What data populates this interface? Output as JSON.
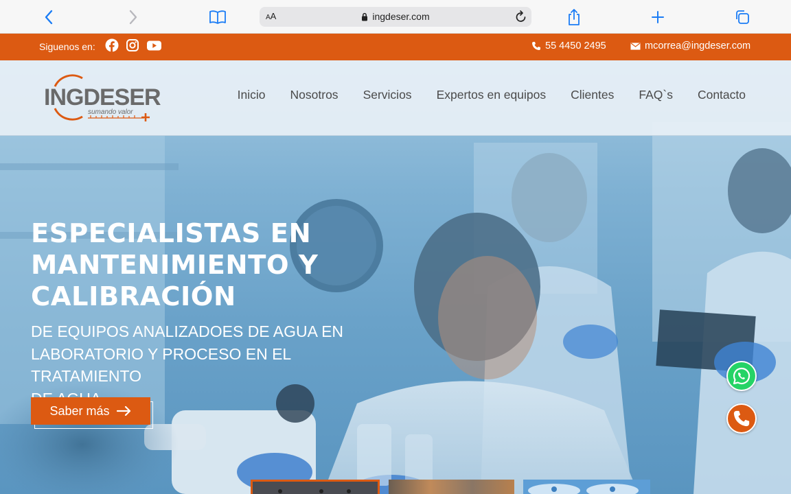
{
  "browser": {
    "aa_small": "A",
    "aa_large": "A",
    "url": "ingdeser.com"
  },
  "topbar": {
    "follow_label": "Siguenos en:",
    "phone": "55 4450 2495",
    "email": "mcorrea@ingdeser.com"
  },
  "header": {
    "logo_text": "INGDESER",
    "logo_tagline": "sumando valor",
    "nav": [
      "Inicio",
      "Nosotros",
      "Servicios",
      "Expertos en equipos",
      "Clientes",
      "FAQ`s",
      "Contacto"
    ]
  },
  "hero": {
    "headline": [
      "ESPECIALISTAS EN",
      "MANTENIMIENTO Y",
      "CALIBRACIÓN"
    ],
    "subheadline": [
      "DE EQUIPOS ANALIZADOES DE AGUA EN",
      "LABORATORIO Y PROCESO EN EL TRATAMIENTO",
      "DE AGUA."
    ],
    "cta_label": "Saber más"
  },
  "colors": {
    "brand_orange": "#dc5a12",
    "whatsapp_green": "#25d366",
    "ios_blue": "#1a7cf5"
  },
  "icons": {
    "social": [
      "facebook-icon",
      "instagram-icon",
      "youtube-icon"
    ],
    "floating": [
      "whatsapp-icon",
      "phone-icon"
    ]
  }
}
